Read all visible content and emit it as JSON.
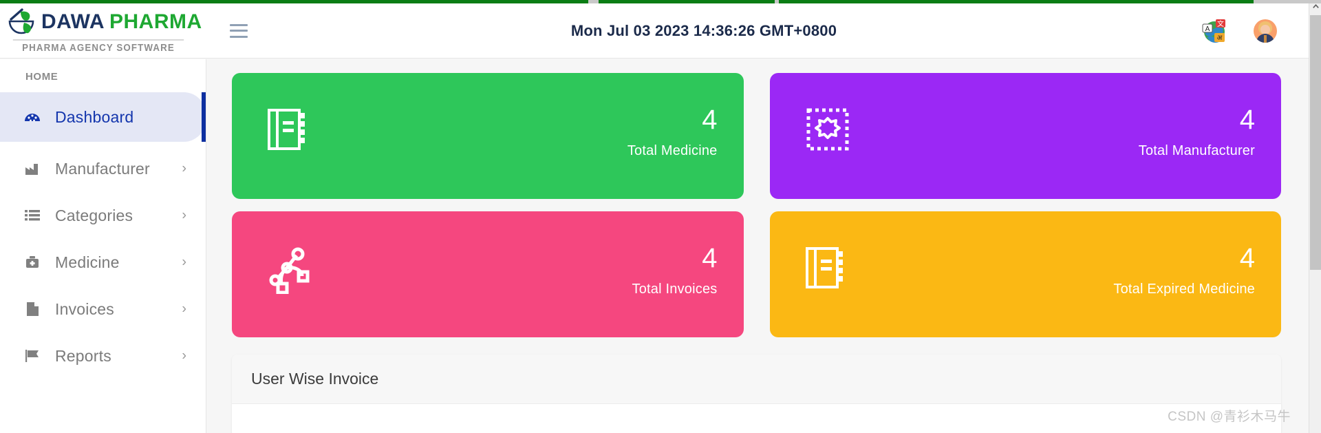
{
  "brand": {
    "name_first": "DAWA",
    "name_second": "PHARMA",
    "tagline": "PHARMA AGENCY SOFTWARE",
    "logo_icon": "mortar-pestle-leaf-icon",
    "color_first": "#1c3461",
    "color_second": "#1ea832"
  },
  "header": {
    "menu_icon": "hamburger-menu-icon",
    "datetime": "Mon Jul 03 2023 14:36:26 GMT+0800",
    "translate_icon": "globe-translate-icon",
    "avatar_icon": "user-avatar-icon"
  },
  "sidebar": {
    "section_label": "HOME",
    "items": [
      {
        "label": "Dashboard",
        "icon": "dashboard-gauge-icon",
        "active": true,
        "chevron": ""
      },
      {
        "label": "Manufacturer",
        "icon": "factory-icon",
        "active": false,
        "chevron": "›"
      },
      {
        "label": "Categories",
        "icon": "list-icon",
        "active": false,
        "chevron": "›"
      },
      {
        "label": "Medicine",
        "icon": "medical-kit-icon",
        "active": false,
        "chevron": "›"
      },
      {
        "label": "Invoices",
        "icon": "document-icon",
        "active": false,
        "chevron": "›"
      },
      {
        "label": "Reports",
        "icon": "flag-icon",
        "active": false,
        "chevron": "›"
      }
    ],
    "active_accent_color": "#0d2fa0",
    "active_bg_color": "#e4e7f5"
  },
  "stats": [
    {
      "value": "4",
      "label": "Total Medicine",
      "color": "#2ec75a",
      "icon": "ledger-book-icon"
    },
    {
      "value": "4",
      "label": "Total Manufacturer",
      "color": "#9b28f5",
      "icon": "dashed-badge-icon"
    },
    {
      "value": "4",
      "label": "Total Invoices",
      "color": "#f5477f",
      "icon": "node-path-icon"
    },
    {
      "value": "4",
      "label": "Total Expired Medicine",
      "color": "#fbb814",
      "icon": "ledger-book-icon"
    }
  ],
  "panel": {
    "title": "User Wise Invoice"
  },
  "scrollbar": {
    "up_arrow_icon": "chevron-up-icon"
  },
  "watermark": {
    "text": "CSDN @青衫木马牛"
  }
}
